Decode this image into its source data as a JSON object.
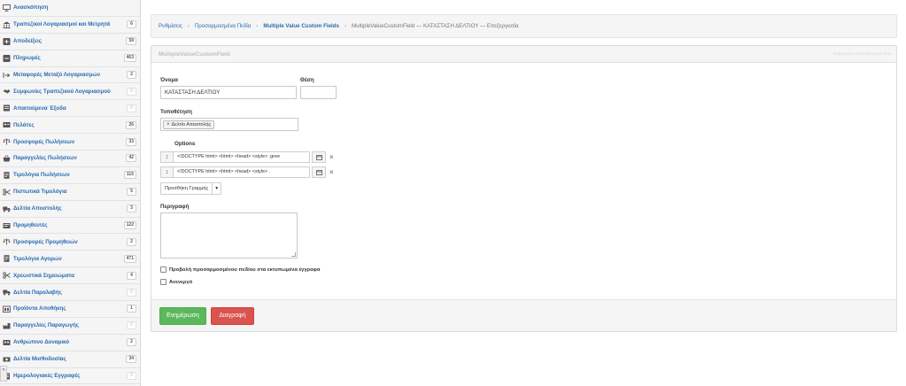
{
  "sidebar": {
    "items": [
      {
        "label": "Ανασκόπηση",
        "icon": "monitor-icon",
        "badge": ""
      },
      {
        "label": "Τραπεζικοί Λογαριασμοί και Μετρητά",
        "icon": "bank-icon",
        "badge": "6"
      },
      {
        "label": "Αποδείξεις",
        "icon": "plus-square-icon",
        "badge": "59"
      },
      {
        "label": "Πληρωμές",
        "icon": "minus-square-icon",
        "badge": "463"
      },
      {
        "label": "Μεταφορές Μεταξύ Λογαριασμών",
        "icon": "transfer-icon",
        "badge": "2"
      },
      {
        "label": "Συμφωνίες Τραπεζικού Λογαριασμού",
        "icon": "handshake-icon",
        "badge": "0"
      },
      {
        "label": "Απαιτούμενα Έξοδα",
        "icon": "receipt-icon",
        "badge": "0"
      },
      {
        "label": "Πελάτες",
        "icon": "customers-icon",
        "badge": "26"
      },
      {
        "label": "Προσφορές Πωλήσεων",
        "icon": "scale-icon",
        "badge": "33"
      },
      {
        "label": "Παραγγελίες Πωλήσεων",
        "icon": "basket-icon",
        "badge": "42"
      },
      {
        "label": "Τιμολόγια Πωλήσεων",
        "icon": "invoice-icon",
        "badge": "115"
      },
      {
        "label": "Πιστωτικά Τιμολόγια",
        "icon": "scissors-icon",
        "badge": "5"
      },
      {
        "label": "Δελτία Αποστολής",
        "icon": "truck-icon",
        "badge": "3"
      },
      {
        "label": "Προμηθευτές",
        "icon": "suppliers-icon",
        "badge": "122"
      },
      {
        "label": "Προσφορές Προμηθειών",
        "icon": "scale-icon",
        "badge": "2"
      },
      {
        "label": "Τιμολόγια Αγορών",
        "icon": "invoice-icon",
        "badge": "471"
      },
      {
        "label": "Χρεωστικά Σημειώματα",
        "icon": "scissors-icon",
        "badge": "4"
      },
      {
        "label": "Δελτία Παραλαβής",
        "icon": "truck-icon",
        "badge": "0"
      },
      {
        "label": "Προϊόντα Αποθήκης",
        "icon": "inventory-icon",
        "badge": "1"
      },
      {
        "label": "Παραγγελίες Παραγωγής",
        "icon": "factory-icon",
        "badge": "0"
      },
      {
        "label": "Ανθρώπινο Δυναμικό",
        "icon": "people-icon",
        "badge": "2"
      },
      {
        "label": "Δελτία Μισθοδοσίας",
        "icon": "payslip-icon",
        "badge": "34"
      },
      {
        "label": "Ημερολογιακές Εγγραφές",
        "icon": "journal-icon",
        "badge": "0"
      }
    ]
  },
  "breadcrumb": {
    "items": [
      "Ρυθμίσεις",
      "Προσαρμοσμένα Πεδία",
      "Multiple Value Custom Fields"
    ],
    "current": "MultipleValueCustomField — ΚΑΤΑΣΤΑΣΗ ΔΕΛΤΙΟΥ — Επεξεργασία"
  },
  "panel": {
    "title": "MultipleValueCustomField",
    "meta": "Ενημέρωση τελευταία φορά πριν"
  },
  "form": {
    "name_label": "Όνομα",
    "name_value": "ΚΑΤΑΣΤΑΣΗ ΔΕΛΤΙΟΥ",
    "position_label": "Θέση",
    "position_value": "",
    "placement_label": "Τοποθέτηση",
    "placement_tag": "Δελτίο Αποστολής",
    "options_label": "Options",
    "options": [
      "<!DOCTYPE html>  <html>  <head>  <style>      .gree",
      "<!DOCTYPE html>  <html>    <head>     <style>      ."
    ],
    "add_line_label": "Προσθήκη Γραμμής",
    "description_label": "Περιγραφή",
    "description_value": "",
    "show_printed_label": "Προβολή προσαρμοσμένου πεδίου στα εκτυπωμένα έγγραφα",
    "inactive_label": "Ανενεργό"
  },
  "actions": {
    "update_label": "Ενημέρωση",
    "delete_label": "Διαγραφή"
  },
  "colors": {
    "link": "#2c6db3",
    "success": "#5cb85c",
    "danger": "#d9534f"
  }
}
